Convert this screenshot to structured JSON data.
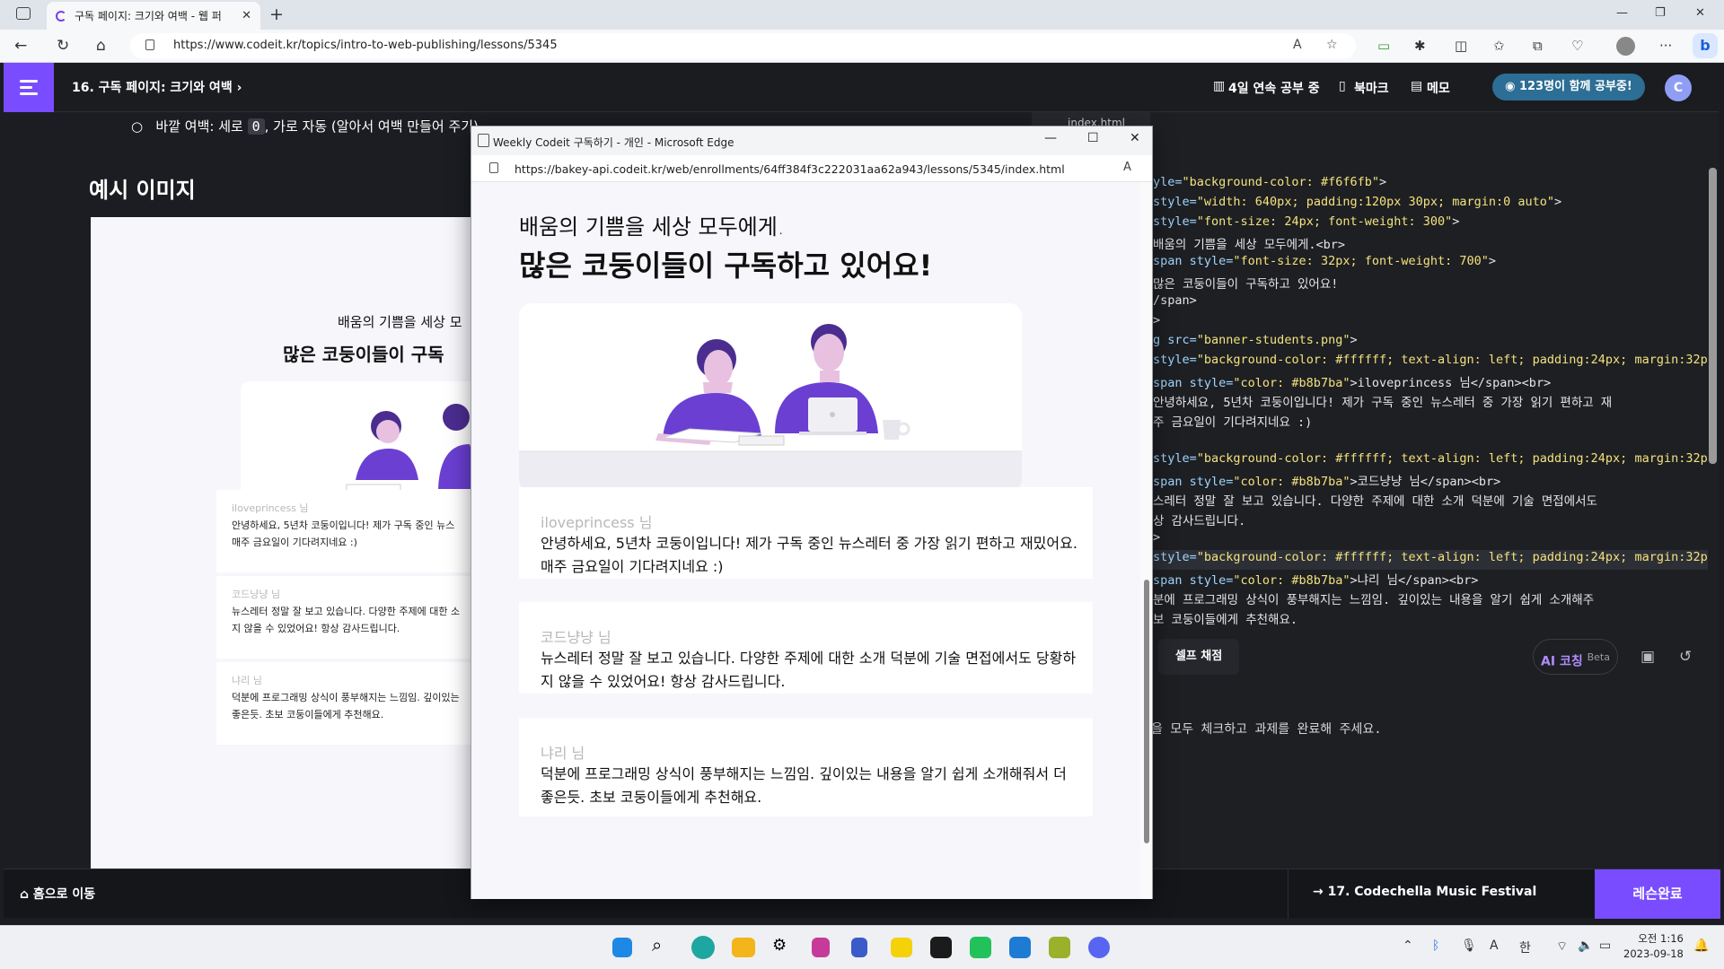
{
  "browser": {
    "tab_title": "구독 페이지: 크기와 여백 - 웹 퍼",
    "new_tab": "+",
    "url": "https://www.codeit.kr/topics/intro-to-web-publishing/lessons/5345",
    "reader_icon": "A",
    "bing": "b"
  },
  "header": {
    "lesson_title": "16. 구독 페이지: 크기와 여백  ›",
    "streak": "4일 연속 공부 중",
    "bookmark": "북마크",
    "memo": "메모",
    "study_together": "◉ 123명이 함께 공부중!",
    "user_initial": "C"
  },
  "lesson": {
    "bullet_pre": "바깥 여백: 세로 ",
    "bullet_code": "0",
    "bullet_post": ", 가로 자동 (알아서 여백 만들어 주기)",
    "example_heading": "예시 이미지",
    "example_lead": "배움의 기쁨을 세상 모",
    "example_head": "많은 코둥이들이 구독",
    "example_cards": [
      {
        "name": "iloveprincess 님",
        "text": "안녕하세요, 5년차 코둥이입니다! 제가 구독 중인 뉴스",
        "text2": "매주 금요일이 기다려지네요 :)"
      },
      {
        "name": "코드냥냥 님",
        "text": "뉴스레터 정말 잘 보고 있습니다. 다양한 주제에 대한 소",
        "text2": "지 않을 수 있었어요! 항상 감사드립니다."
      },
      {
        "name": "냐리 님",
        "text": "덕분에 프로그래밍 상식이 풍부해지는 느낌임. 깊이있는",
        "text2": "좋은듯. 초보 코둥이들에게 추천해요."
      }
    ]
  },
  "editor": {
    "tab": "index.html",
    "lines": [
      {
        "k": "yle=",
        "s": "\"background-color: #f6f6fb\"",
        "p": ">"
      },
      {
        "k": "style=",
        "s": "\"width: 640px; padding:120px 30px; margin:0 auto\"",
        "p": ">"
      },
      {
        "k": "  style=",
        "s": "\"font-size: 24px; font-weight: 300\"",
        "p": ">"
      },
      {
        "k": "",
        "s": "",
        "p": "배움의 기쁨을 세상 모두에게.<br>"
      },
      {
        "k": "span style=",
        "s": "\"font-size: 32px; font-weight: 700\"",
        "p": ">"
      },
      {
        "k": "",
        "s": "",
        "p": " 많은 코둥이들이 구독하고 있어요!"
      },
      {
        "k": "",
        "s": "",
        "p": "/span>"
      },
      {
        "k": "",
        "s": "",
        "p": ">"
      },
      {
        "k": "g src=",
        "s": "\"banner-students.png\"",
        "p": ">"
      },
      {
        "k": "style=",
        "s": "\"background-color: #ffffff; text-align: left; padding:24px; margin:32p",
        "p": ""
      },
      {
        "k": "span style=",
        "s": "\"color: #b8b7ba\"",
        "p": ">iloveprincess 님</span><br>"
      },
      {
        "k": "",
        "s": "",
        "p": "안녕하세요, 5년차 코둥이입니다! 제가 구독 중인 뉴스레터 중 가장 읽기 편하고 재"
      },
      {
        "k": "",
        "s": "",
        "p": "주 금요일이 기다려지네요 :)"
      },
      {
        "k": "",
        "s": "",
        "p": ""
      },
      {
        "k": "style=",
        "s": "\"background-color: #ffffff; text-align: left; padding:24px; margin:32p",
        "p": ""
      },
      {
        "k": "span style=",
        "s": "\"color: #b8b7ba\"",
        "p": ">코드냥냥 님</span><br>"
      },
      {
        "k": "",
        "s": "",
        "p": "스레터 정말 잘 보고 있습니다. 다양한 주제에 대한 소개 덕분에 기술 면접에서도"
      },
      {
        "k": "",
        "s": "",
        "p": "상 감사드립니다."
      },
      {
        "k": "",
        "s": "",
        "p": ">"
      },
      {
        "k": "style=",
        "s": "\"background-color: #ffffff; text-align: left; padding:24px; margin:32p",
        "p": ""
      },
      {
        "k": "span style=",
        "s": "\"color: #b8b7ba\"",
        "p": ">냐리 님</span><br>"
      },
      {
        "k": "",
        "s": "",
        "p": "분에 프로그래밍 상식이 풍부해지는 느낌임. 깊이있는 내용을 알기 쉽게 소개해주"
      },
      {
        "k": "",
        "s": "",
        "p": "보 코둥이들에게 추천해요."
      }
    ],
    "self_grade": "셀프 채점",
    "ai_label": "AI 코칭",
    "ai_beta": "Beta",
    "instruction": "을 모두 체크하고 과제를 완료해 주세요."
  },
  "bottom": {
    "home": "⌂ 홈으로 이동",
    "next": "→   17. Codechella Music Festival",
    "complete": "레슨완료"
  },
  "popup": {
    "title": "Weekly Codeit 구독하기 - 개인 - Microsoft Edge",
    "url": "https://bakey-api.codeit.kr/web/enrollments/64ff384f3c222031aa62a943/lessons/5345/index.html",
    "reader": "A",
    "lead": "배움의 기쁨을 세상 모두에게.",
    "head": "많은 코둥이들이 구독하고 있어요!",
    "cards": [
      {
        "name": "iloveprincess 님",
        "text": "안녕하세요, 5년차 코둥이입니다! 제가 구독 중인 뉴스레터 중 가장 읽기 편하고 재밌어요.",
        "text2": "매주 금요일이 기다려지네요 :)"
      },
      {
        "name": "코드냥냥 님",
        "text": "뉴스레터 정말 잘 보고 있습니다. 다양한 주제에 대한 소개 덕분에 기술 면접에서도 당황하",
        "text2": "지 않을 수 있었어요! 항상 감사드립니다."
      },
      {
        "name": "냐리 님",
        "text": "덕분에 프로그래밍 상식이 풍부해지는 느낌임. 깊이있는 내용을 알기 쉽게 소개해줘서 더",
        "text2": "좋은듯. 초보 코둥이들에게 추천해요."
      }
    ]
  },
  "taskbar": {
    "time": "오전 1:16",
    "date": "2023-09-18",
    "lang": "한",
    "font_ico": "A"
  },
  "colors": {
    "accent": "#7a4cff",
    "name_gray": "#b8b7ba",
    "page_bg": "#f6f6fb"
  }
}
